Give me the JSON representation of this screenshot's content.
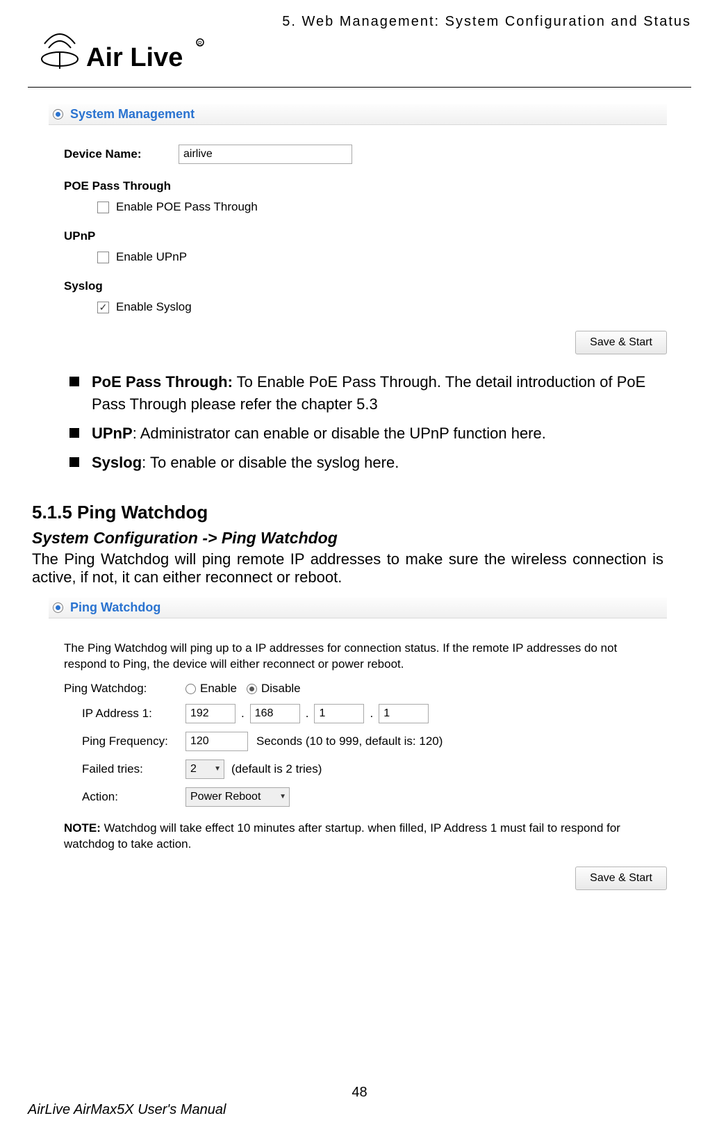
{
  "header": {
    "chapter": "5. Web Management: System Configuration and Status",
    "logo_alt": "Air Live"
  },
  "sys_mgmt": {
    "title": "System Management",
    "device_name_label": "Device Name:",
    "device_name_value": "airlive",
    "poe_heading": "POE Pass Through",
    "poe_checkbox_label": "Enable POE Pass Through",
    "upnp_heading": "UPnP",
    "upnp_checkbox_label": "Enable UPnP",
    "syslog_heading": "Syslog",
    "syslog_checkbox_label": "Enable Syslog",
    "save_button": "Save & Start"
  },
  "bullets": {
    "poe_title": "PoE Pass Through:",
    "poe_text": " To Enable PoE Pass Through. The detail introduction of PoE Pass Through please refer the chapter 5.3",
    "upnp_title": "UPnP",
    "upnp_text": ": Administrator can enable or disable the UPnP function here.",
    "syslog_title": "Syslog",
    "syslog_text": ": To enable or disable the syslog here."
  },
  "section": {
    "heading": "5.1.5 Ping Watchdog",
    "breadcrumb": "System Configuration -> Ping Watchdog",
    "intro": "The Ping Watchdog will ping remote IP addresses to make sure the wireless connection is active, if not, it can either reconnect or reboot."
  },
  "ping": {
    "title": "Ping Watchdog",
    "desc": "The Ping Watchdog will ping up to a IP addresses for connection status. If the remote IP addresses do not respond to Ping, the device will either reconnect or power reboot.",
    "row_label": "Ping Watchdog:",
    "enable": "Enable",
    "disable": "Disable",
    "ip_label": "IP Address 1:",
    "ip": [
      "192",
      "168",
      "1",
      "1"
    ],
    "freq_label": "Ping Frequency:",
    "freq_value": "120",
    "freq_suffix": "Seconds (10 to 999, default is: 120)",
    "failed_label": "Failed tries:",
    "failed_value": "2",
    "failed_suffix": "(default is 2 tries)",
    "action_label": "Action:",
    "action_value": "Power Reboot",
    "note_bold": "NOTE:",
    "note_text": " Watchdog will take effect 10 minutes after startup. when filled, IP Address 1 must fail to respond for watchdog to take action.",
    "save_button": "Save & Start"
  },
  "footer": {
    "page_number": "48",
    "manual": "AirLive AirMax5X User's Manual"
  }
}
